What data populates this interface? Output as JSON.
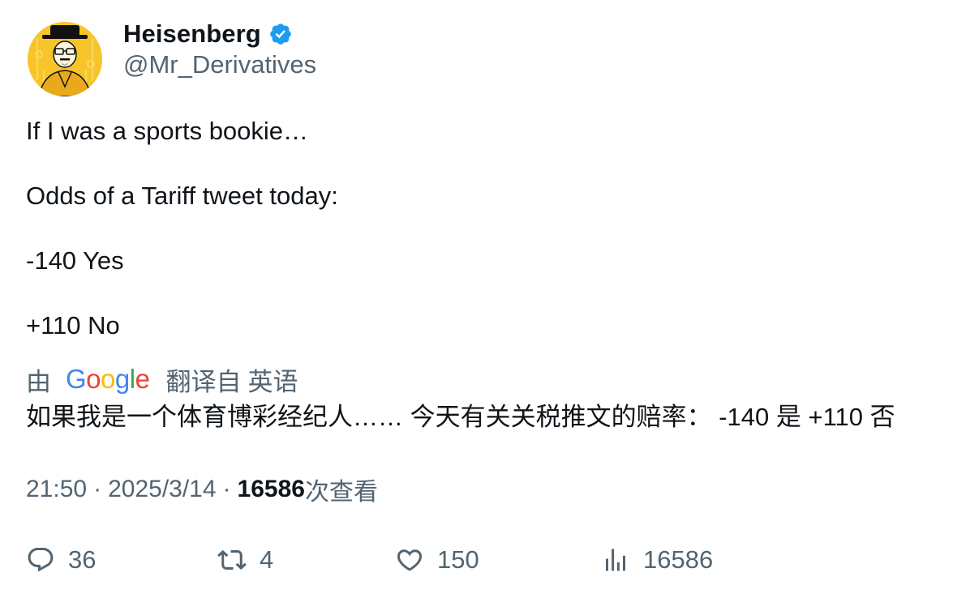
{
  "user": {
    "display_name": "Heisenberg",
    "handle": "@Mr_Derivatives",
    "verified": true
  },
  "tweet": {
    "lines": [
      "If I was a sports bookie…",
      "Odds of a Tariff tweet today:",
      "-140 Yes",
      "+110 No"
    ]
  },
  "translation": {
    "by_label": "由",
    "provider_letters": [
      "G",
      "o",
      "o",
      "g",
      "l",
      "e"
    ],
    "translated_from_label": "翻译自",
    "language": "英语",
    "text": "如果我是一个体育博彩经纪人…… 今天有关关税推文的赔率： -140 是 +110 否"
  },
  "meta": {
    "time": "21:50",
    "separator": "·",
    "date": "2025/3/14",
    "views_count": "16586",
    "views_label": "次查看"
  },
  "actions": {
    "reply_count": "36",
    "retweet_count": "4",
    "like_count": "150",
    "views_count": "16586"
  },
  "colors": {
    "verified_blue": "#1d9bf0",
    "secondary_text": "#536471",
    "primary_text": "#0f1419",
    "avatar_background": "#f5c518"
  },
  "icons": {
    "verified": "verified-badge-icon",
    "reply": "reply-icon",
    "retweet": "retweet-icon",
    "like": "heart-icon",
    "views": "analytics-bar-icon"
  }
}
